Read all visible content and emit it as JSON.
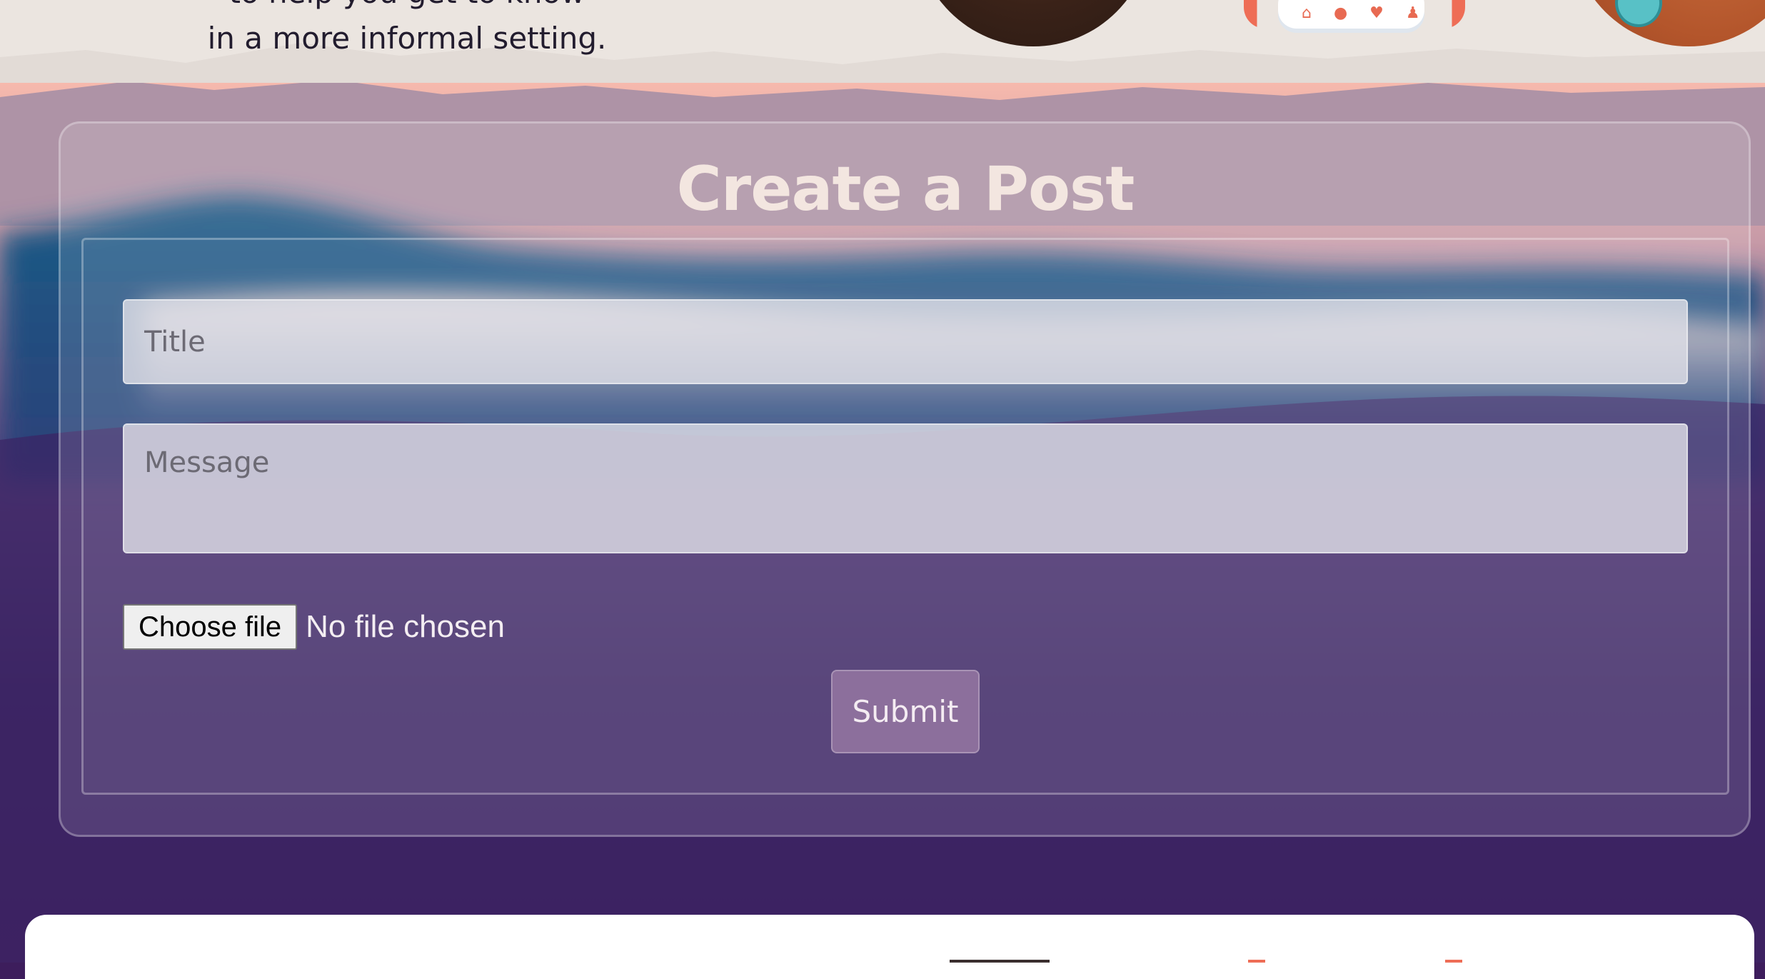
{
  "hero": {
    "text_line_partial": "to help you get to know",
    "text_line_full": "in a more informal setting.",
    "phone_icons": "⌂ ● ♥ ♟"
  },
  "post_form": {
    "heading": "Create a Post",
    "title_placeholder": "Title",
    "message_placeholder": "Message",
    "file_button_label": "Choose file",
    "file_status": "No file chosen",
    "submit_label": "Submit"
  },
  "colors": {
    "accent_submit": "#8c6f9c",
    "heading": "#f3e6e0",
    "brand_coral": "#ee6d56"
  }
}
